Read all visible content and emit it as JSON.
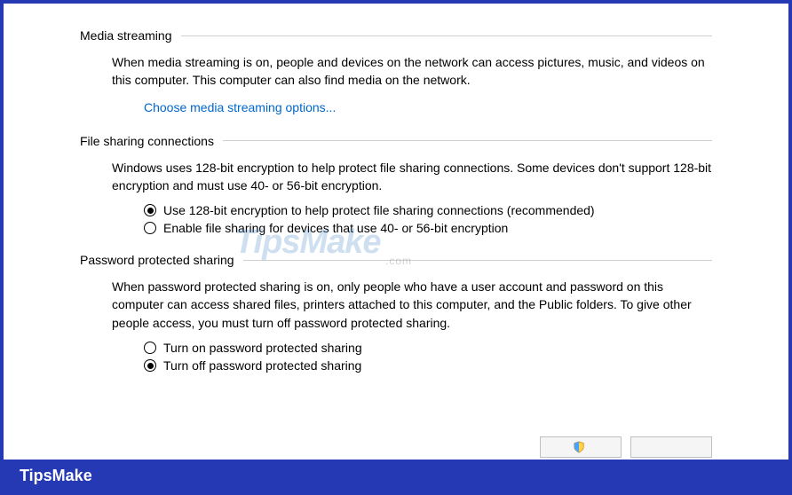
{
  "sections": {
    "media": {
      "title": "Media streaming",
      "desc": "When media streaming is on, people and devices on the network can access pictures, music, and videos on this computer. This computer can also find media on the network.",
      "link": "Choose media streaming options..."
    },
    "fileSharing": {
      "title": "File sharing connections",
      "desc": "Windows uses 128-bit encryption to help protect file sharing connections. Some devices don't support 128-bit encryption and must use 40- or 56-bit encryption.",
      "opt1": "Use 128-bit encryption to help protect file sharing connections (recommended)",
      "opt2": "Enable file sharing for devices that use 40- or 56-bit encryption",
      "selected": 1
    },
    "password": {
      "title": "Password protected sharing",
      "desc": "When password protected sharing is on, only people who have a user account and password on this computer can access shared files, printers attached to this computer, and the Public folders. To give other people access, you must turn off password protected sharing.",
      "opt1": "Turn on password protected sharing",
      "opt2": "Turn off password protected sharing",
      "selected": 2
    }
  },
  "watermark": {
    "main": "TipsMake",
    "sub": ".com"
  },
  "footer": "TipsMake"
}
